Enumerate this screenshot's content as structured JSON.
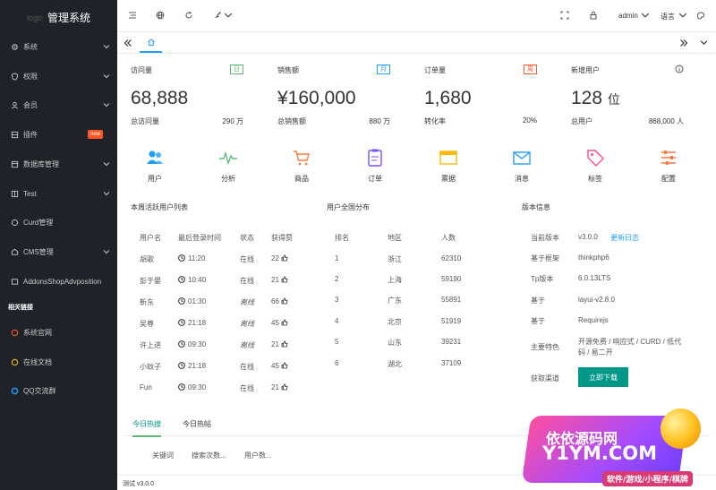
{
  "sidebar": {
    "logo_faint": "logo",
    "logo_title": "管理系统",
    "items": [
      {
        "label": "系统",
        "icon": "gear-icon",
        "has_arrow": true
      },
      {
        "label": "权限",
        "icon": "shield-icon",
        "has_arrow": true
      },
      {
        "label": "会员",
        "icon": "user-icon",
        "has_arrow": true
      },
      {
        "label": "插件",
        "icon": "plugin-icon",
        "badge": "new"
      },
      {
        "label": "数据库管理",
        "icon": "database-icon",
        "has_arrow": true
      },
      {
        "label": "Test",
        "icon": "grid-icon",
        "has_arrow": true
      },
      {
        "label": "Curd管理",
        "icon": "edit-icon"
      },
      {
        "label": "CMS管理",
        "icon": "cms-icon",
        "has_arrow": true
      },
      {
        "label": "AddonsShopAdvposition",
        "icon": "image-icon"
      }
    ],
    "section_title": "相关链接",
    "links": [
      {
        "label": "系统官网",
        "icon": "globe-icon",
        "color": "#ff5722"
      },
      {
        "label": "在线文档",
        "icon": "doc-icon",
        "color": "#ffb800"
      },
      {
        "label": "QQ交流群",
        "icon": "qq-icon",
        "color": "#1e9fff"
      }
    ]
  },
  "header": {
    "user": "admin",
    "language": "语言",
    "icons": [
      "menu-toggle-icon",
      "globe-icon",
      "refresh-icon",
      "brush-icon",
      "fullscreen-icon",
      "lock-icon",
      "theme-icon"
    ]
  },
  "stats": [
    {
      "title": "访问量",
      "badge": "日",
      "badge_color": "#5fb878",
      "value": "68,888",
      "foot_label": "总访问量",
      "foot_value": "290 万"
    },
    {
      "title": "销售额",
      "badge": "月",
      "badge_color": "#1e9fff",
      "value": "¥160,000",
      "foot_label": "总销售额",
      "foot_value": "880 万"
    },
    {
      "title": "订单量",
      "badge": "周",
      "badge_color": "#ff5722",
      "value": "1,680",
      "foot_label": "转化率",
      "foot_value": "20%"
    },
    {
      "title": "新增用户",
      "badge": "",
      "value": "128",
      "value_unit": "位",
      "foot_label": "总用户",
      "foot_value": "868,000 人"
    }
  ],
  "quick_links": [
    {
      "label": "用户",
      "icon": "users-icon",
      "color": "#1e9fff"
    },
    {
      "label": "分析",
      "icon": "pulse-icon",
      "color": "#5fb878"
    },
    {
      "label": "商品",
      "icon": "cart-icon",
      "color": "#ff7e45"
    },
    {
      "label": "订单",
      "icon": "clipboard-icon",
      "color": "#7c4dff"
    },
    {
      "label": "票据",
      "icon": "ticket-icon",
      "color": "#ffb800"
    },
    {
      "label": "消息",
      "icon": "mail-icon",
      "color": "#1e9fff"
    },
    {
      "label": "标签",
      "icon": "tag-icon",
      "color": "#ff4d8d"
    },
    {
      "label": "配置",
      "icon": "sliders-icon",
      "color": "#ff7e45"
    }
  ],
  "active_users": {
    "title": "本周活跃用户列表",
    "headers": [
      "用户名",
      "最后登录时间",
      "状态",
      "获得赞"
    ],
    "rows": [
      {
        "name": "胡歌",
        "time": "11:20",
        "status": "在线",
        "likes": "22"
      },
      {
        "name": "彭于晏",
        "time": "10:40",
        "status": "在线",
        "likes": "21"
      },
      {
        "name": "靳东",
        "time": "01:30",
        "status": "离线",
        "likes": "66"
      },
      {
        "name": "吴尊",
        "time": "21:18",
        "status": "离线",
        "likes": "45"
      },
      {
        "name": "许上进",
        "time": "09:30",
        "status": "离线",
        "likes": "21"
      },
      {
        "name": "小蚊子",
        "time": "21:18",
        "status": "在线",
        "likes": "45"
      },
      {
        "name": "Fun",
        "time": "09:30",
        "status": "在线",
        "likes": "21"
      }
    ]
  },
  "distribution": {
    "title": "用户全国分布",
    "headers": [
      "排名",
      "地区",
      "人数"
    ],
    "rows": [
      {
        "rank": "1",
        "region": "浙江",
        "count": "62310"
      },
      {
        "rank": "2",
        "region": "上海",
        "count": "59190"
      },
      {
        "rank": "3",
        "region": "广东",
        "count": "55891"
      },
      {
        "rank": "4",
        "region": "北京",
        "count": "51919"
      },
      {
        "rank": "5",
        "region": "山东",
        "count": "39231"
      },
      {
        "rank": "6",
        "region": "湖北",
        "count": "37109"
      }
    ]
  },
  "version": {
    "title": "版本信息",
    "rows": [
      {
        "label": "当前版本",
        "value": "v3.0.0",
        "link": "更新日志"
      },
      {
        "label": "基于框架",
        "value": "thinkphp6"
      },
      {
        "label": "Tp版本",
        "value": "6.0.13LTS"
      },
      {
        "label": "基于",
        "value": "layui-v2.8.0"
      },
      {
        "label": "基于",
        "value": "Requirejs"
      },
      {
        "label": "主要特色",
        "value": "开源免费 / 响应式 / CURD / 低代码 / 易二开"
      },
      {
        "label": "获取渠道",
        "button": "立即下载"
      }
    ]
  },
  "bottom_tabs": {
    "tabs": [
      "今日热搜",
      "今日热帖"
    ],
    "headers": [
      "关键词",
      "搜索次数...",
      "用户数..."
    ]
  },
  "footer": {
    "text": "测试 v3.0.0"
  },
  "watermark": {
    "line1": "依依源码网",
    "line2": "Y1YM.COM",
    "line3": "软件/游戏/小程序/棋牌"
  }
}
